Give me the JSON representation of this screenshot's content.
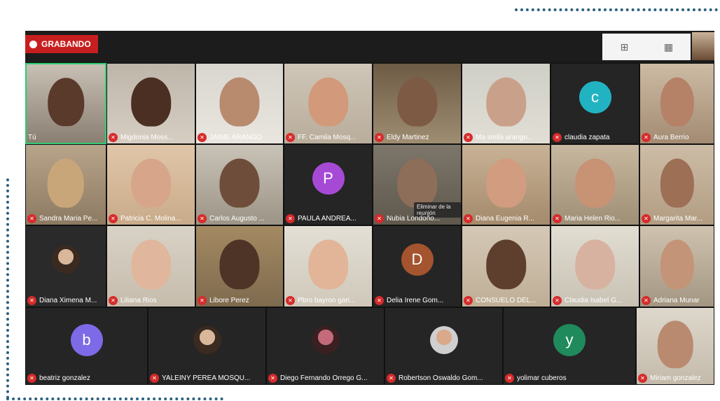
{
  "recording": {
    "label": "GRABANDO"
  },
  "toolbar": {
    "icons": [
      "speaker-view-icon",
      "gallery-view-icon"
    ]
  },
  "hover_tooltip": "Eliminar de la reunión",
  "participants": [
    "Tú",
    "Migdonia Moss...",
    "JAIME ARANGO",
    "FF. Camila Mosq...",
    "Eldy Martinez",
    "Ma stella arango...",
    "claudia zapata",
    "Aura Berrio",
    "Sandra Maria Pe...",
    "Patricia C. Molina...",
    "Carlos Augusto ...",
    "PAULA ANDREA...",
    "Nubia Londoño...",
    "Diana Eugenia R...",
    "Maria Helen Rio...",
    "Margarita Mar...",
    "Diana Ximena M...",
    "Liliana Rios",
    "Libore Perez",
    "Pbro bayron gari...",
    "Delia Irene Gom...",
    "CONSUELO DEL...",
    "Claudia Isabel G...",
    "Adriana Munar",
    "beatriz gonzalez",
    "YALEINY PEREA MOSQU...",
    "Diego Fernando Orrego G...",
    "Robertson Oswaldo Gom...",
    "yolimar cuberos",
    "Miriam gonzalez"
  ],
  "avatars": {
    "claudia": "c",
    "paula": "P",
    "delia": "D",
    "beatriz": "b",
    "yolimar": "y"
  },
  "colors": {
    "recording": "#c71f1f",
    "mute": "#d62b2b",
    "active_speaker": "#2ecc71",
    "dots": "#2a5f7e"
  }
}
